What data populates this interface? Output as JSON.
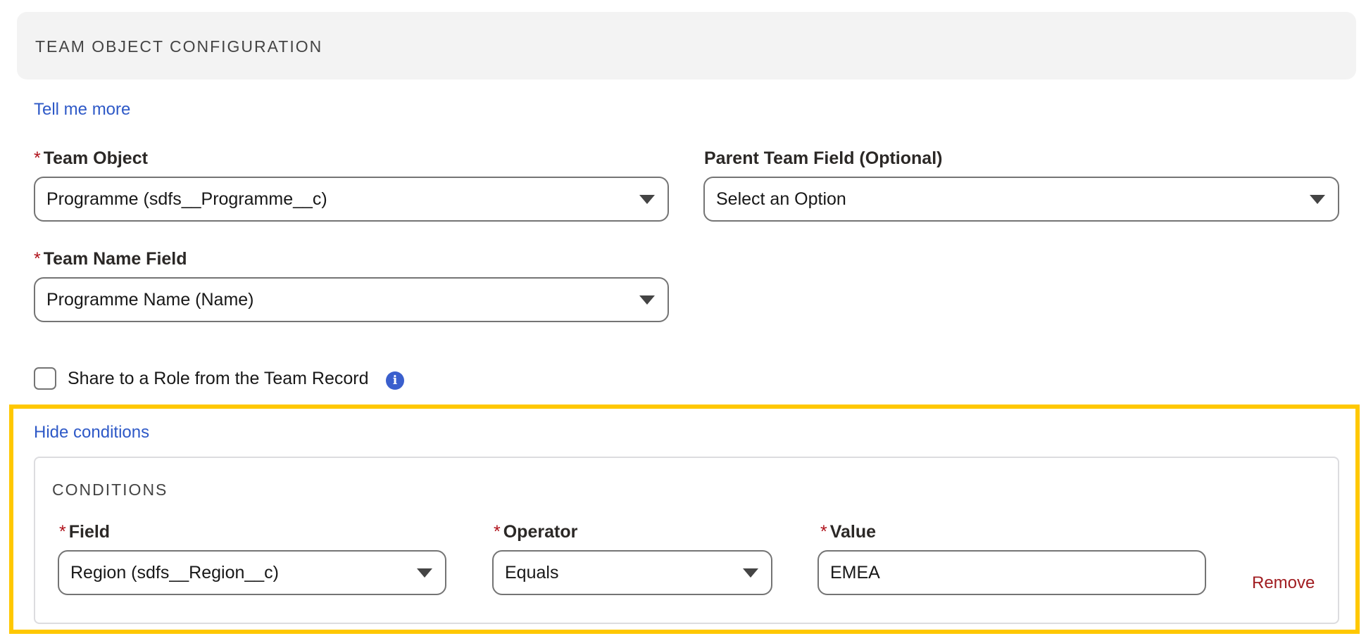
{
  "header": {
    "title": "TEAM OBJECT CONFIGURATION"
  },
  "tell_me_more": "Tell me more",
  "team_object": {
    "label": "Team Object",
    "required_mark": "*",
    "value": "Programme (sdfs__Programme__c)"
  },
  "parent_team_field": {
    "label": "Parent Team Field (Optional)",
    "value": "Select an Option"
  },
  "team_name_field": {
    "label": "Team Name Field",
    "required_mark": "*",
    "value": "Programme Name (Name)"
  },
  "share_role": {
    "label": "Share to a Role from the Team Record",
    "checked": false,
    "info_icon": "info-icon"
  },
  "hide_conditions": "Hide conditions",
  "conditions": {
    "title": "CONDITIONS",
    "field": {
      "label": "Field",
      "required_mark": "*",
      "value": "Region (sdfs__Region__c)"
    },
    "operator": {
      "label": "Operator",
      "required_mark": "*",
      "value": "Equals"
    },
    "value": {
      "label": "Value",
      "required_mark": "*",
      "value": "EMEA"
    },
    "remove_label": "Remove"
  },
  "colors": {
    "link": "#2e59c7",
    "required": "#b0121b",
    "remove": "#a11d21",
    "highlight": "#ffc800",
    "info_icon_bg": "#3a5fcd"
  }
}
